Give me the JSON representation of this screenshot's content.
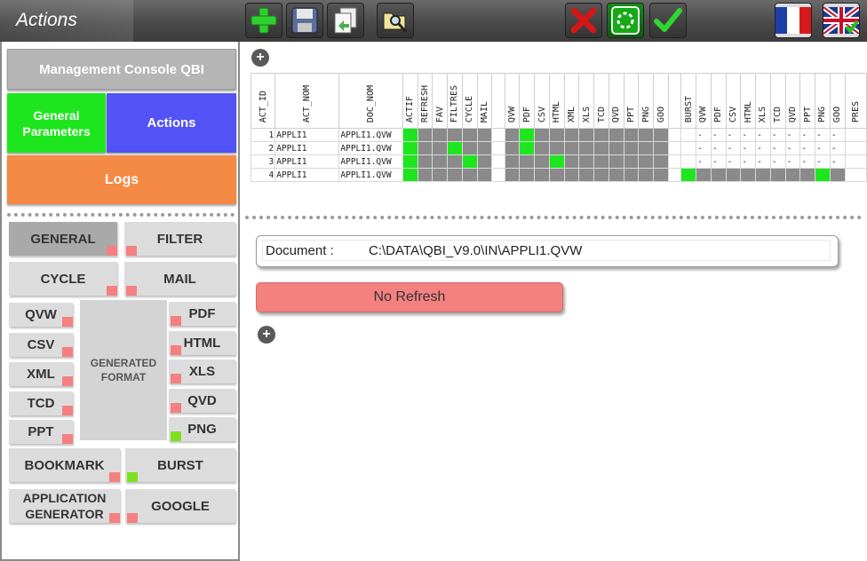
{
  "app": {
    "title": "Actions"
  },
  "toolbar": {
    "icons": [
      "add-icon",
      "save-icon",
      "copy-icon",
      "folder-search-icon",
      "delete-icon",
      "refresh-icon",
      "validate-icon",
      "flag-fr-icon",
      "flag-en-icon"
    ]
  },
  "sidebar": {
    "management": "Management Console QBI",
    "general": "General Parameters",
    "actions": "Actions",
    "logs": "Logs",
    "filters": {
      "general": "GENERAL",
      "filter": "FILTER",
      "cycle": "CYCLE",
      "mail": "MAIL",
      "qvw": "QVW",
      "csv": "CSV",
      "xml": "XML",
      "tcd": "TCD",
      "ppt": "PPT",
      "pdf": "PDF",
      "html": "HTML",
      "xls": "XLS",
      "qvd": "QVD",
      "png": "PNG",
      "generated_format": "GENERATED FORMAT",
      "bookmark": "BOOKMARK",
      "burst": "BURST",
      "application_generator": "APPLICATION GENERATOR",
      "google": "GOOGLE"
    }
  },
  "grid": {
    "headers": [
      "ACT_ID",
      "ACT_NOM",
      "DOC_NOM",
      "ACTIF",
      "REFRESH",
      "FAV",
      "FILTRES",
      "CYCLE",
      "MAIL",
      "",
      "QVW",
      "PDF",
      "CSV",
      "HTML",
      "XML",
      "XLS",
      "TCD",
      "QVD",
      "PPT",
      "PNG",
      "GOO",
      "",
      "BURST",
      "QVW",
      "PDF",
      "CSV",
      "HTML",
      "XLS",
      "TCD",
      "QVD",
      "PPT",
      "PNG",
      "GOO",
      "PRES"
    ],
    "rows": [
      {
        "id": "1",
        "nom": "APPLI1",
        "doc": "APPLI1.QVW",
        "dash": "-"
      },
      {
        "id": "2",
        "nom": "APPLI1",
        "doc": "APPLI1.QVW",
        "dash": "-"
      },
      {
        "id": "3",
        "nom": "APPLI1",
        "doc": "APPLI1.QVW",
        "dash": "-"
      },
      {
        "id": "4",
        "nom": "APPLI1",
        "doc": "APPLI1.QVW",
        "dash": ""
      }
    ]
  },
  "document": {
    "label": "Document :",
    "value": "C:\\DATA\\QBI_V9.0\\IN\\APPLI1.QVW"
  },
  "status": {
    "refresh": "No Refresh"
  },
  "colors": {
    "green": "#1ee61e",
    "blue": "#5353f5",
    "orange": "#f58a45",
    "red_marker": "#f48080",
    "grey_cell": "#8a8a8a"
  }
}
